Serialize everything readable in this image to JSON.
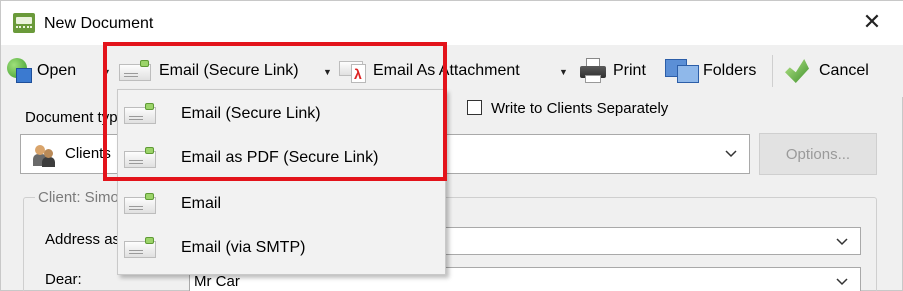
{
  "window": {
    "title": "New Document",
    "close_glyph": "✕"
  },
  "toolbar": {
    "open_label": "Open",
    "email_secure_label": "Email (Secure Link)",
    "email_attachment_label": "Email As Attachment",
    "print_label": "Print",
    "folders_label": "Folders",
    "cancel_label": "Cancel",
    "dropdown_glyph": "▼"
  },
  "form": {
    "document_type_label": "Document type",
    "write_separately_label": "Write to Clients Separately",
    "write_separately_checked": false,
    "recipient_value": "Clients",
    "options_label": "Options...",
    "client_group_title": "Client: Simon Car",
    "address_as_label": "Address as",
    "dear_label": "Dear:",
    "dear_value": "Mr Car"
  },
  "email_menu": {
    "items": [
      {
        "label": "Email (Secure Link)",
        "icon": "email-icon"
      },
      {
        "label": "Email as PDF (Secure Link)",
        "icon": "email-icon"
      },
      {
        "label": "Email",
        "icon": "email-icon"
      },
      {
        "label": "Email (via SMTP)",
        "icon": "email-icon"
      }
    ]
  },
  "colors": {
    "highlight": "#e3131b",
    "window_bg": "#f0f0f0"
  }
}
